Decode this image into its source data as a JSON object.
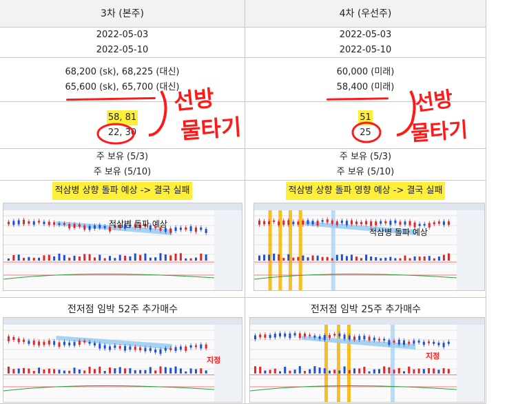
{
  "columns": [
    {
      "header": "3차 (본주)",
      "dates": [
        "2022-05-03",
        "2022-05-10"
      ],
      "prices": [
        "68,200 (sk), 68,225 (대신)",
        "65,600 (sk), 65,700 (대신)"
      ],
      "qty": [
        "58, 81",
        "22, 30"
      ],
      "holding": [
        "주 보유 (5/3)",
        "주 보유 (5/10)"
      ],
      "banner": "적삼병 상향 돌파 예상 -> 결국 실패",
      "chart_note": "적삼병 돌파 예상",
      "caption": "전저점 임박 52주 추가매수",
      "chart2_note": "지정"
    },
    {
      "header": "4차 (우선주)",
      "dates": [
        "2022-05-03",
        "2022-05-10"
      ],
      "prices": [
        "60,000 (미래)",
        "58,400 (미래)"
      ],
      "qty": [
        "51",
        "25"
      ],
      "holding": [
        "주 보유 (5/3)",
        "주 보유 (5/10)"
      ],
      "banner": "적삼병 상향 돌파 영향 예상 -> 결국 실패",
      "chart_note": "적삼병 돌파 예상",
      "caption": "전저점 임박 25주 추가매수",
      "chart2_note": "지정"
    }
  ],
  "annotations": {
    "left_handwriting": [
      "선방",
      "물타기"
    ],
    "right_handwriting": [
      "선방",
      "물타기"
    ]
  },
  "colors": {
    "highlight": "#ffef3a",
    "marker": "#ff1a1a",
    "up": "#e0262b",
    "down": "#1f4fd6"
  }
}
